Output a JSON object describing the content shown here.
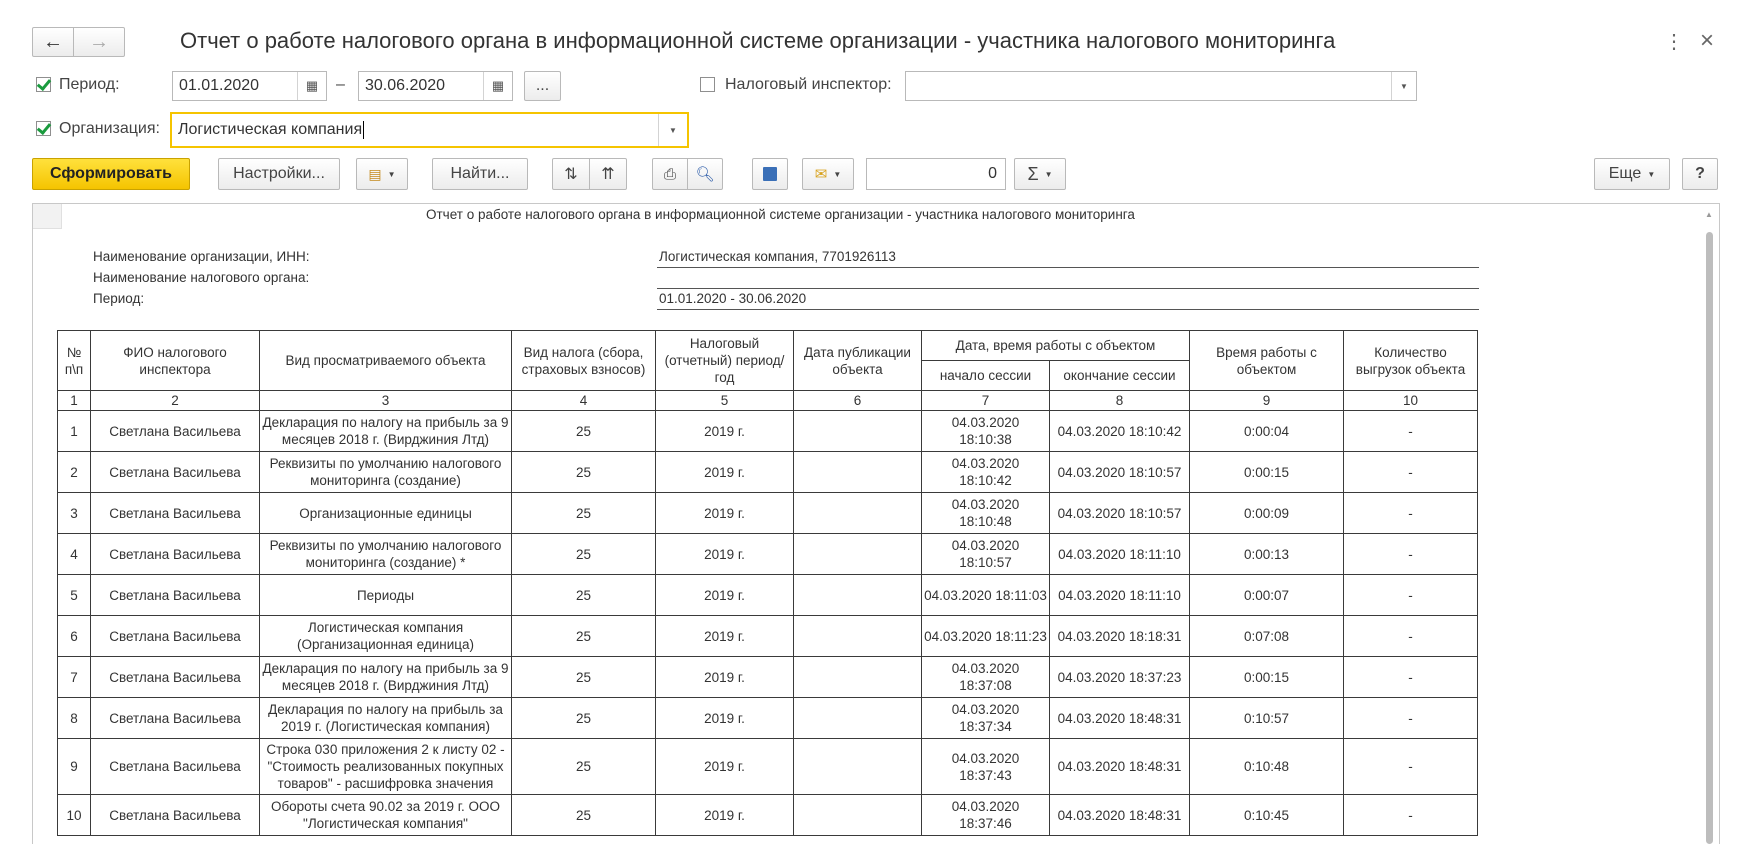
{
  "window": {
    "title": "Отчет о работе налогового органа в информационной системе организации - участника налогового мониторинга",
    "back_icon": "←",
    "forward_icon": "→",
    "more_icon": "⋮",
    "close_icon": "×"
  },
  "filters": {
    "period_label": "Период:",
    "period_checked": true,
    "date_from": "01.01.2020",
    "dash": "–",
    "date_to": "30.06.2020",
    "period_more": "...",
    "inspector_label": "Налоговый инспектор:",
    "inspector_checked": false,
    "inspector_value": "",
    "org_label": "Организация:",
    "org_checked": true,
    "org_value": "Логистическая компания"
  },
  "toolbar": {
    "generate": "Сформировать",
    "settings": "Настройки...",
    "find": "Найти...",
    "sum_value": "0",
    "sigma": "Σ",
    "more": "Еще",
    "help": "?"
  },
  "report": {
    "title": "Отчет о работе налогового органа в информационной системе организации - участника налогового мониторинга",
    "org_label": "Наименование организации, ИНН:",
    "org_value": "Логистическая компания, 7701926113",
    "tax_label": "Наименование налогового органа:",
    "tax_value": "",
    "period_label": "Период:",
    "period_value": "01.01.2020 - 30.06.2020",
    "columns": {
      "c1": "№ п\\п",
      "c2": "ФИО налогового инспектора",
      "c3": "Вид просматриваемого объекта",
      "c4": "Вид налога (сбора, страховых взносов)",
      "c5": "Налоговый (отчетный) период/год",
      "c6": "Дата публикации объекта",
      "c78": "Дата, время работы с объектом",
      "c7": "начало сессии",
      "c8": "окончание сессии",
      "c9": "Время работы с объектом",
      "c10": "Количество выгрузок объекта"
    },
    "col_numbers": [
      "1",
      "2",
      "3",
      "4",
      "5",
      "6",
      "7",
      "8",
      "9",
      "10"
    ],
    "rows": [
      {
        "n": "1",
        "name": "Светлана Васильева",
        "obj": "Декларация по налогу на прибыль за 9 месяцев 2018 г. (Вирджиния Лтд)",
        "tax": "25",
        "period": "2019 г.",
        "pub": "",
        "start": "04.03.2020 18:10:38",
        "end": "04.03.2020 18:10:42",
        "time": "0:00:04",
        "cnt": "-"
      },
      {
        "n": "2",
        "name": "Светлана Васильева",
        "obj": "Реквизиты по умолчанию налогового мониторинга (создание)",
        "tax": "25",
        "period": "2019 г.",
        "pub": "",
        "start": "04.03.2020 18:10:42",
        "end": "04.03.2020 18:10:57",
        "time": "0:00:15",
        "cnt": "-"
      },
      {
        "n": "3",
        "name": "Светлана Васильева",
        "obj": "Организационные единицы",
        "tax": "25",
        "period": "2019 г.",
        "pub": "",
        "start": "04.03.2020 18:10:48",
        "end": "04.03.2020 18:10:57",
        "time": "0:00:09",
        "cnt": "-"
      },
      {
        "n": "4",
        "name": "Светлана Васильева",
        "obj": "Реквизиты по умолчанию налогового мониторинга (создание) *",
        "tax": "25",
        "period": "2019 г.",
        "pub": "",
        "start": "04.03.2020 18:10:57",
        "end": "04.03.2020 18:11:10",
        "time": "0:00:13",
        "cnt": "-"
      },
      {
        "n": "5",
        "name": "Светлана Васильева",
        "obj": "Периоды",
        "tax": "25",
        "period": "2019 г.",
        "pub": "",
        "start": "04.03.2020 18:11:03",
        "end": "04.03.2020 18:11:10",
        "time": "0:00:07",
        "cnt": "-"
      },
      {
        "n": "6",
        "name": "Светлана Васильева",
        "obj": "Логистическая компания (Организационная единица)",
        "tax": "25",
        "period": "2019 г.",
        "pub": "",
        "start": "04.03.2020 18:11:23",
        "end": "04.03.2020 18:18:31",
        "time": "0:07:08",
        "cnt": "-"
      },
      {
        "n": "7",
        "name": "Светлана Васильева",
        "obj": "Декларация по налогу на прибыль за 9 месяцев 2018 г. (Вирджиния Лтд)",
        "tax": "25",
        "period": "2019 г.",
        "pub": "",
        "start": "04.03.2020 18:37:08",
        "end": "04.03.2020 18:37:23",
        "time": "0:00:15",
        "cnt": "-"
      },
      {
        "n": "8",
        "name": "Светлана Васильева",
        "obj": "Декларация по налогу на прибыль за 2019 г. (Логистическая компания)",
        "tax": "25",
        "period": "2019 г.",
        "pub": "",
        "start": "04.03.2020 18:37:34",
        "end": "04.03.2020 18:48:31",
        "time": "0:10:57",
        "cnt": "-"
      },
      {
        "n": "9",
        "name": "Светлана Васильева",
        "obj": "Строка 030 приложения 2 к листу 02 - \"Стоимость реализованных покупных товаров\" - расшифровка значения",
        "tax": "25",
        "period": "2019 г.",
        "pub": "",
        "start": "04.03.2020 18:37:43",
        "end": "04.03.2020 18:48:31",
        "time": "0:10:48",
        "cnt": "-"
      },
      {
        "n": "10",
        "name": "Светлана Васильева",
        "obj": "Обороты счета 90.02 за 2019 г. ООО \"Логистическая компания\"",
        "tax": "25",
        "period": "2019 г.",
        "pub": "",
        "start": "04.03.2020 18:37:46",
        "end": "04.03.2020 18:48:31",
        "time": "0:10:45",
        "cnt": "-"
      }
    ]
  }
}
